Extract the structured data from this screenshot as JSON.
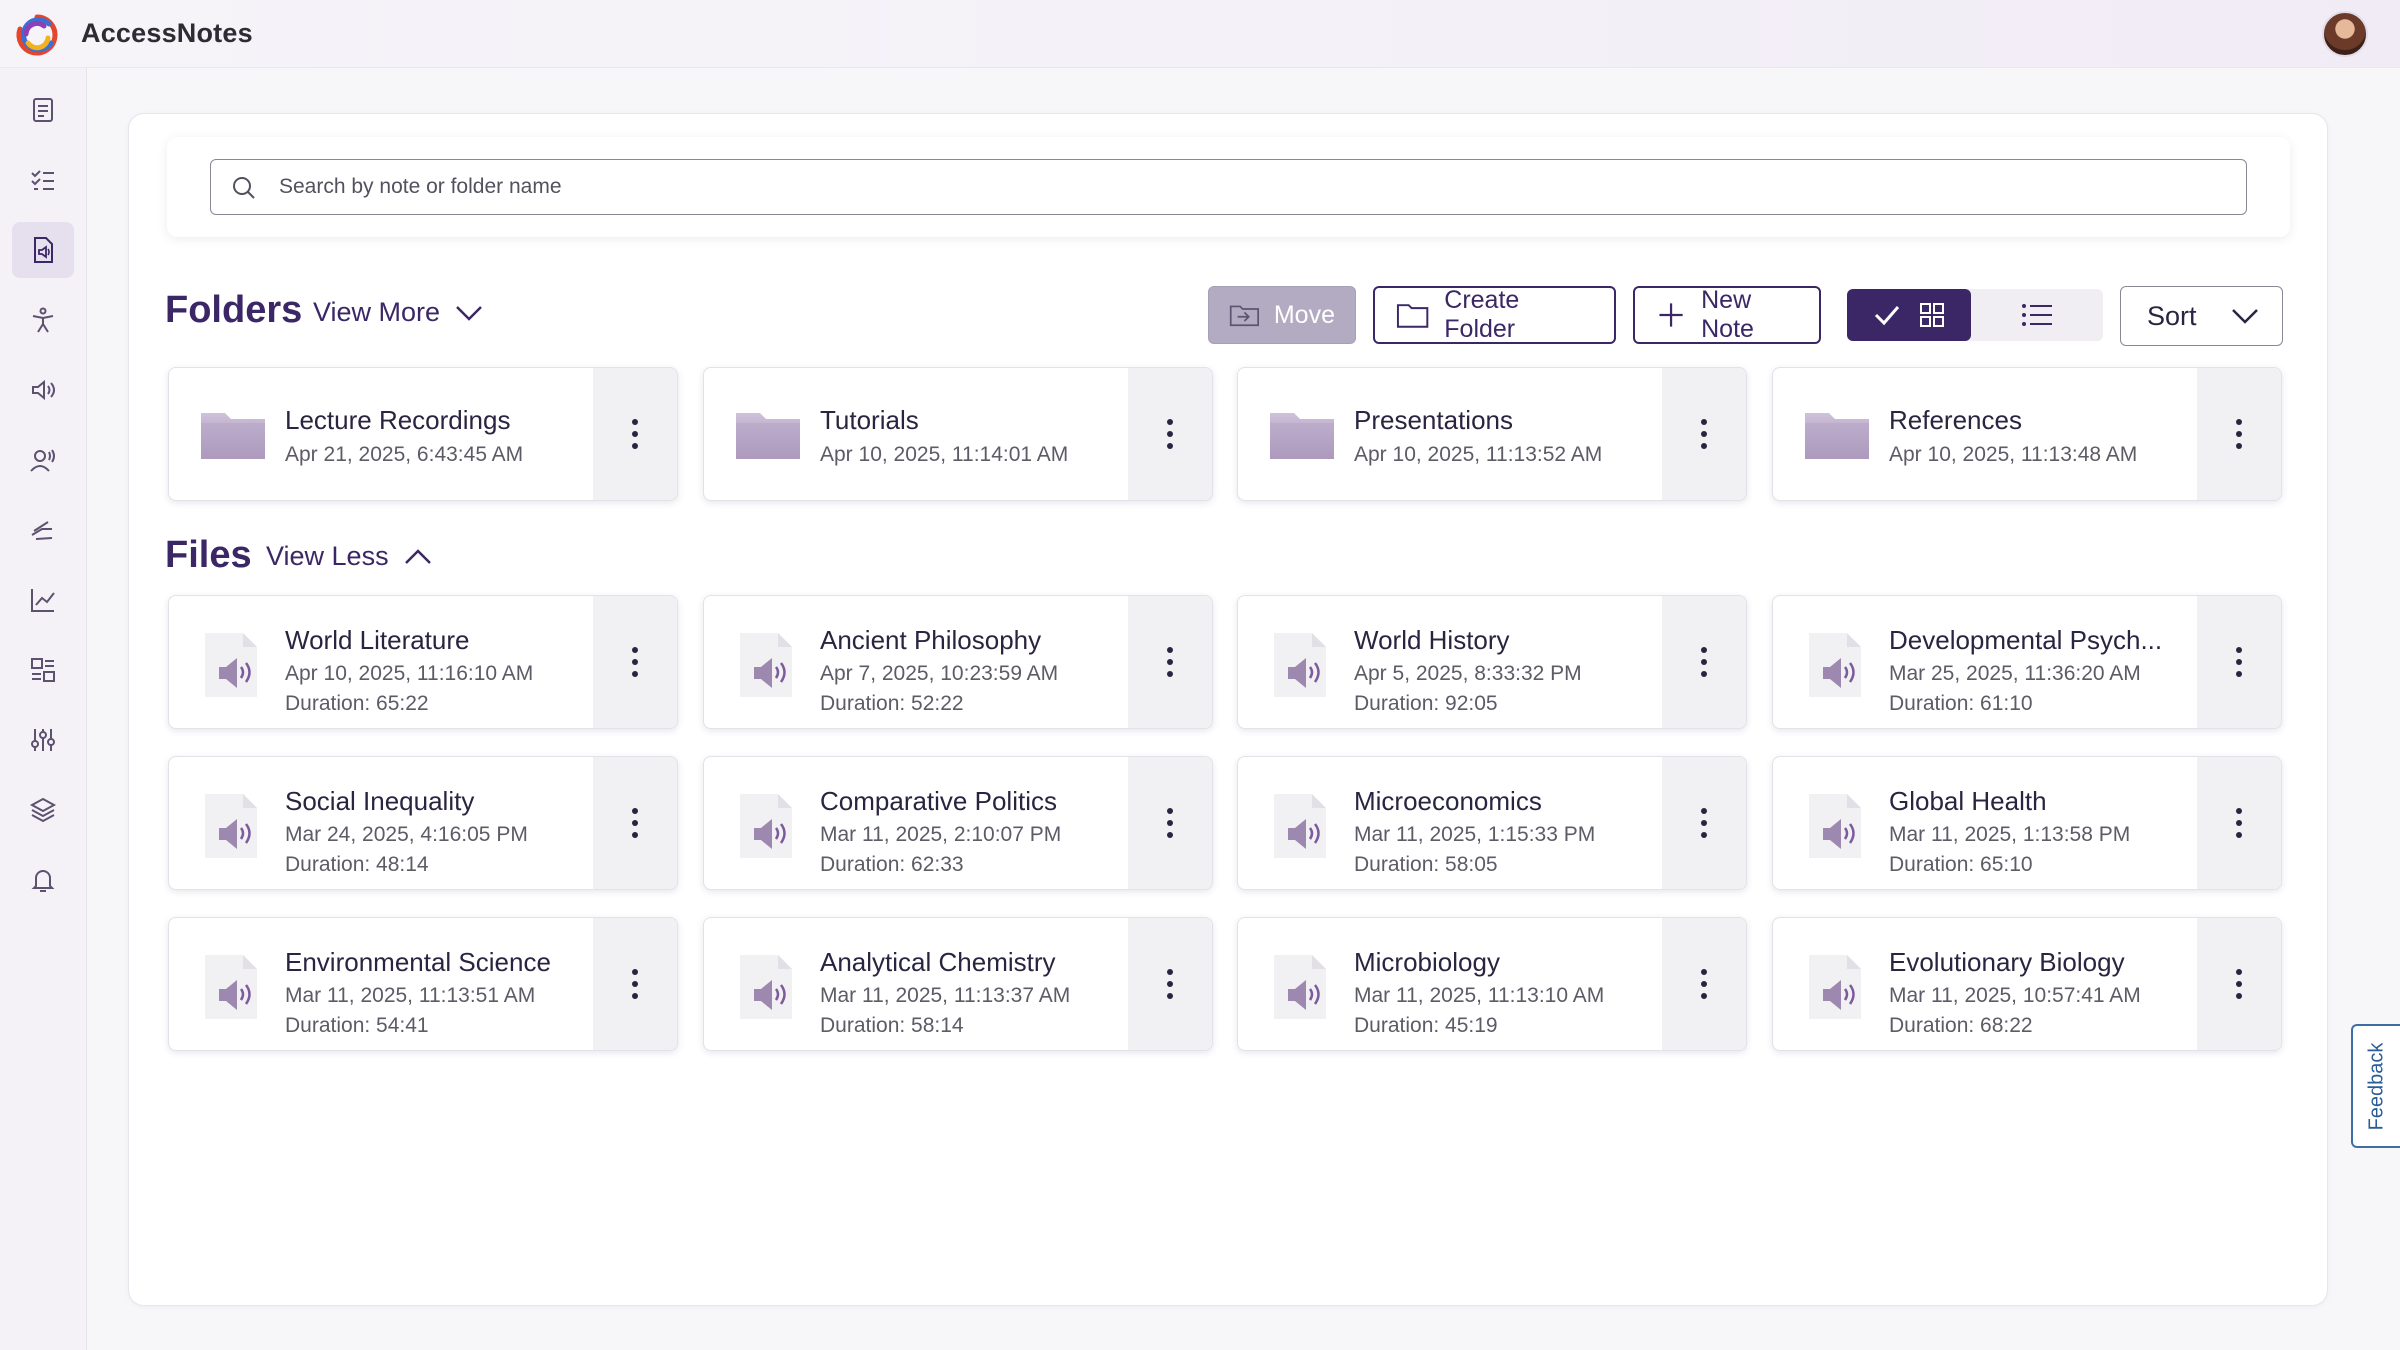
{
  "app": {
    "title": "AccessNotes"
  },
  "sidebar": {
    "items": [
      {
        "icon": "notes-icon",
        "active": false
      },
      {
        "icon": "checklist-icon",
        "active": false
      },
      {
        "icon": "audio-file-icon",
        "active": true
      },
      {
        "icon": "accessibility-icon",
        "active": false
      },
      {
        "icon": "speaker-icon",
        "active": false
      },
      {
        "icon": "voice-user-icon",
        "active": false
      },
      {
        "icon": "sign-language-icon",
        "active": false
      },
      {
        "icon": "analytics-icon",
        "active": false
      },
      {
        "icon": "transcript-icon",
        "active": false
      },
      {
        "icon": "sliders-icon",
        "active": false
      },
      {
        "icon": "layers-icon",
        "active": false
      },
      {
        "icon": "bell-icon",
        "active": false
      }
    ]
  },
  "search": {
    "placeholder": "Search by note or folder name",
    "value": ""
  },
  "folders_section": {
    "title": "Folders",
    "toggle_label": "View More"
  },
  "files_section": {
    "title": "Files",
    "toggle_label": "View Less"
  },
  "toolbar": {
    "move_label": "Move",
    "create_folder_label": "Create Folder",
    "new_note_label": "New Note",
    "sort_label": "Sort",
    "view_mode": "grid"
  },
  "folders": [
    {
      "name": "Lecture Recordings",
      "date": "Apr 21, 2025, 6:43:45 AM"
    },
    {
      "name": "Tutorials",
      "date": "Apr 10, 2025, 11:14:01 AM"
    },
    {
      "name": "Presentations",
      "date": "Apr 10, 2025, 11:13:52 AM"
    },
    {
      "name": "References",
      "date": "Apr 10, 2025, 11:13:48 AM"
    }
  ],
  "files": [
    {
      "name": "World Literature",
      "date": "Apr 10, 2025, 11:16:10 AM",
      "duration": "Duration: 65:22"
    },
    {
      "name": "Ancient Philosophy",
      "date": "Apr 7, 2025, 10:23:59 AM",
      "duration": "Duration: 52:22"
    },
    {
      "name": "World History",
      "date": "Apr 5, 2025, 8:33:32 PM",
      "duration": "Duration: 92:05"
    },
    {
      "name": "Developmental Psych...",
      "date": "Mar 25, 2025, 11:36:20 AM",
      "duration": "Duration: 61:10"
    },
    {
      "name": "Social Inequality",
      "date": "Mar 24, 2025, 4:16:05 PM",
      "duration": "Duration: 48:14"
    },
    {
      "name": "Comparative Politics",
      "date": "Mar 11, 2025, 2:10:07 PM",
      "duration": "Duration: 62:33"
    },
    {
      "name": "Microeconomics",
      "date": "Mar 11, 2025, 1:15:33 PM",
      "duration": "Duration: 58:05"
    },
    {
      "name": "Global Health",
      "date": "Mar 11, 2025, 1:13:58 PM",
      "duration": "Duration: 65:10"
    },
    {
      "name": "Environmental Science",
      "date": "Mar 11, 2025, 11:13:51 AM",
      "duration": "Duration: 54:41"
    },
    {
      "name": "Analytical Chemistry",
      "date": "Mar 11, 2025, 11:13:37 AM",
      "duration": "Duration: 58:14"
    },
    {
      "name": "Microbiology",
      "date": "Mar 11, 2025, 11:13:10 AM",
      "duration": "Duration: 45:19"
    },
    {
      "name": "Evolutionary Biology",
      "date": "Mar 11, 2025, 10:57:41 AM",
      "duration": "Duration: 68:22"
    }
  ],
  "feedback": {
    "label": "Feedback"
  },
  "colors": {
    "primary": "#3b2766",
    "folder": "#a996b8",
    "accent": "#7d5a9c"
  }
}
